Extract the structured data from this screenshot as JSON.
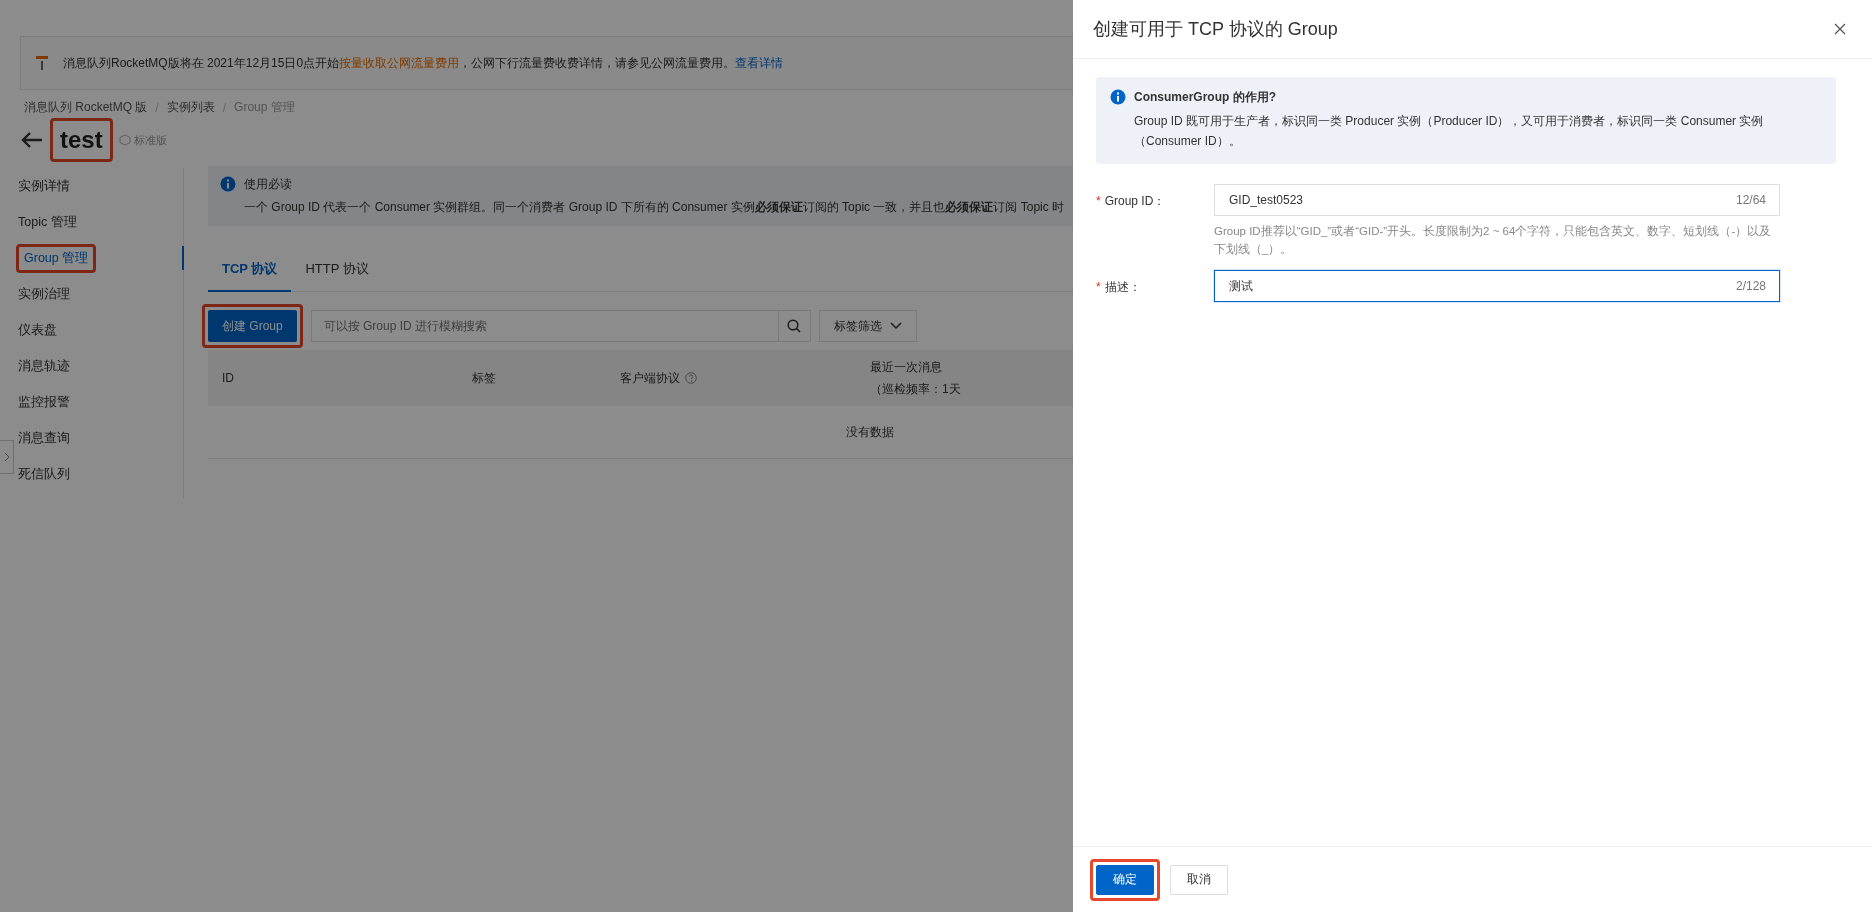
{
  "banner": {
    "message": [
      {
        "text": "消息队列RocketMQ版将在 2021年12月15日0点开始",
        "kind": "plain"
      },
      {
        "text": "按量收取公网流量费用",
        "kind": "emphasis"
      },
      {
        "text": "，公网下行流量费收费详情，请参见公网流量费用。",
        "kind": "plain"
      }
    ],
    "link": "查看详情"
  },
  "breadcrumb": {
    "separator": "/",
    "items": [
      "消息队列 RocketMQ 版",
      "实例列表",
      "Group 管理"
    ]
  },
  "header": {
    "title": "test",
    "highlighted": true,
    "badge": "标准版"
  },
  "sidebar": {
    "items": [
      {
        "label": "实例详情",
        "selected": false,
        "highlighted": false
      },
      {
        "label": "Topic 管理",
        "selected": false,
        "highlighted": false
      },
      {
        "label": "Group 管理",
        "selected": true,
        "highlighted": true
      },
      {
        "label": "实例治理",
        "selected": false,
        "highlighted": false
      },
      {
        "label": "仪表盘",
        "selected": false,
        "highlighted": false
      },
      {
        "label": "消息轨迹",
        "selected": false,
        "highlighted": false
      },
      {
        "label": "监控报警",
        "selected": false,
        "highlighted": false
      },
      {
        "label": "消息查询",
        "selected": false,
        "highlighted": false
      },
      {
        "label": "死信队列",
        "selected": false,
        "highlighted": false
      }
    ]
  },
  "notice": {
    "title": "使用必读",
    "text": "一个 Group ID 代表一个 Consumer 实例群组。同一个消费者 Group ID 下所有的 Consumer 实例**必须保证**订阅的 Topic 一致，并且也**必须保证**订阅 Topic 时"
  },
  "tabs": [
    {
      "label": "TCP 协议",
      "selected": true
    },
    {
      "label": "HTTP 协议",
      "selected": false
    }
  ],
  "toolbar": {
    "create_button": {
      "label": "创建 Group",
      "highlighted": true
    },
    "search": {
      "placeholder": "可以按 Group ID 进行模糊搜索"
    },
    "tag_filter": "标签筛选"
  },
  "table": {
    "columns": [
      {
        "label": "ID",
        "kind": "plain"
      },
      {
        "label": "标签",
        "kind": "plain"
      },
      {
        "label": "客户端协议",
        "kind": "help"
      },
      {
        "label": "最近一次消息",
        "sublabel": "（巡检频率：1天",
        "kind": "twoline"
      }
    ],
    "empty_text": "没有数据"
  },
  "drawer": {
    "title": "创建可用于 TCP 协议的 Group",
    "info": {
      "title": "ConsumerGroup 的作用?",
      "text": "Group ID 既可用于生产者，标识同一类 Producer 实例（Producer ID），又可用于消费者，标识同一类 Consumer 实例（Consumer ID）。"
    },
    "fields": [
      {
        "marker": "*",
        "label": "Group ID：",
        "value": "GID_test0523",
        "counter": "12/64",
        "help": "Group ID推荐以“GID_”或者“GID-”开头。长度限制为2 ~ 64个字符，只能包含英文、数字、短划线（-）以及下划线（_）。",
        "focused": false
      },
      {
        "marker": "*",
        "label": "描述：",
        "value": "测试",
        "counter": "2/128",
        "focused": true
      }
    ],
    "buttons": [
      {
        "label": "确定",
        "kind": "primary",
        "highlighted": true
      },
      {
        "label": "取消",
        "kind": "default",
        "highlighted": false
      }
    ]
  }
}
